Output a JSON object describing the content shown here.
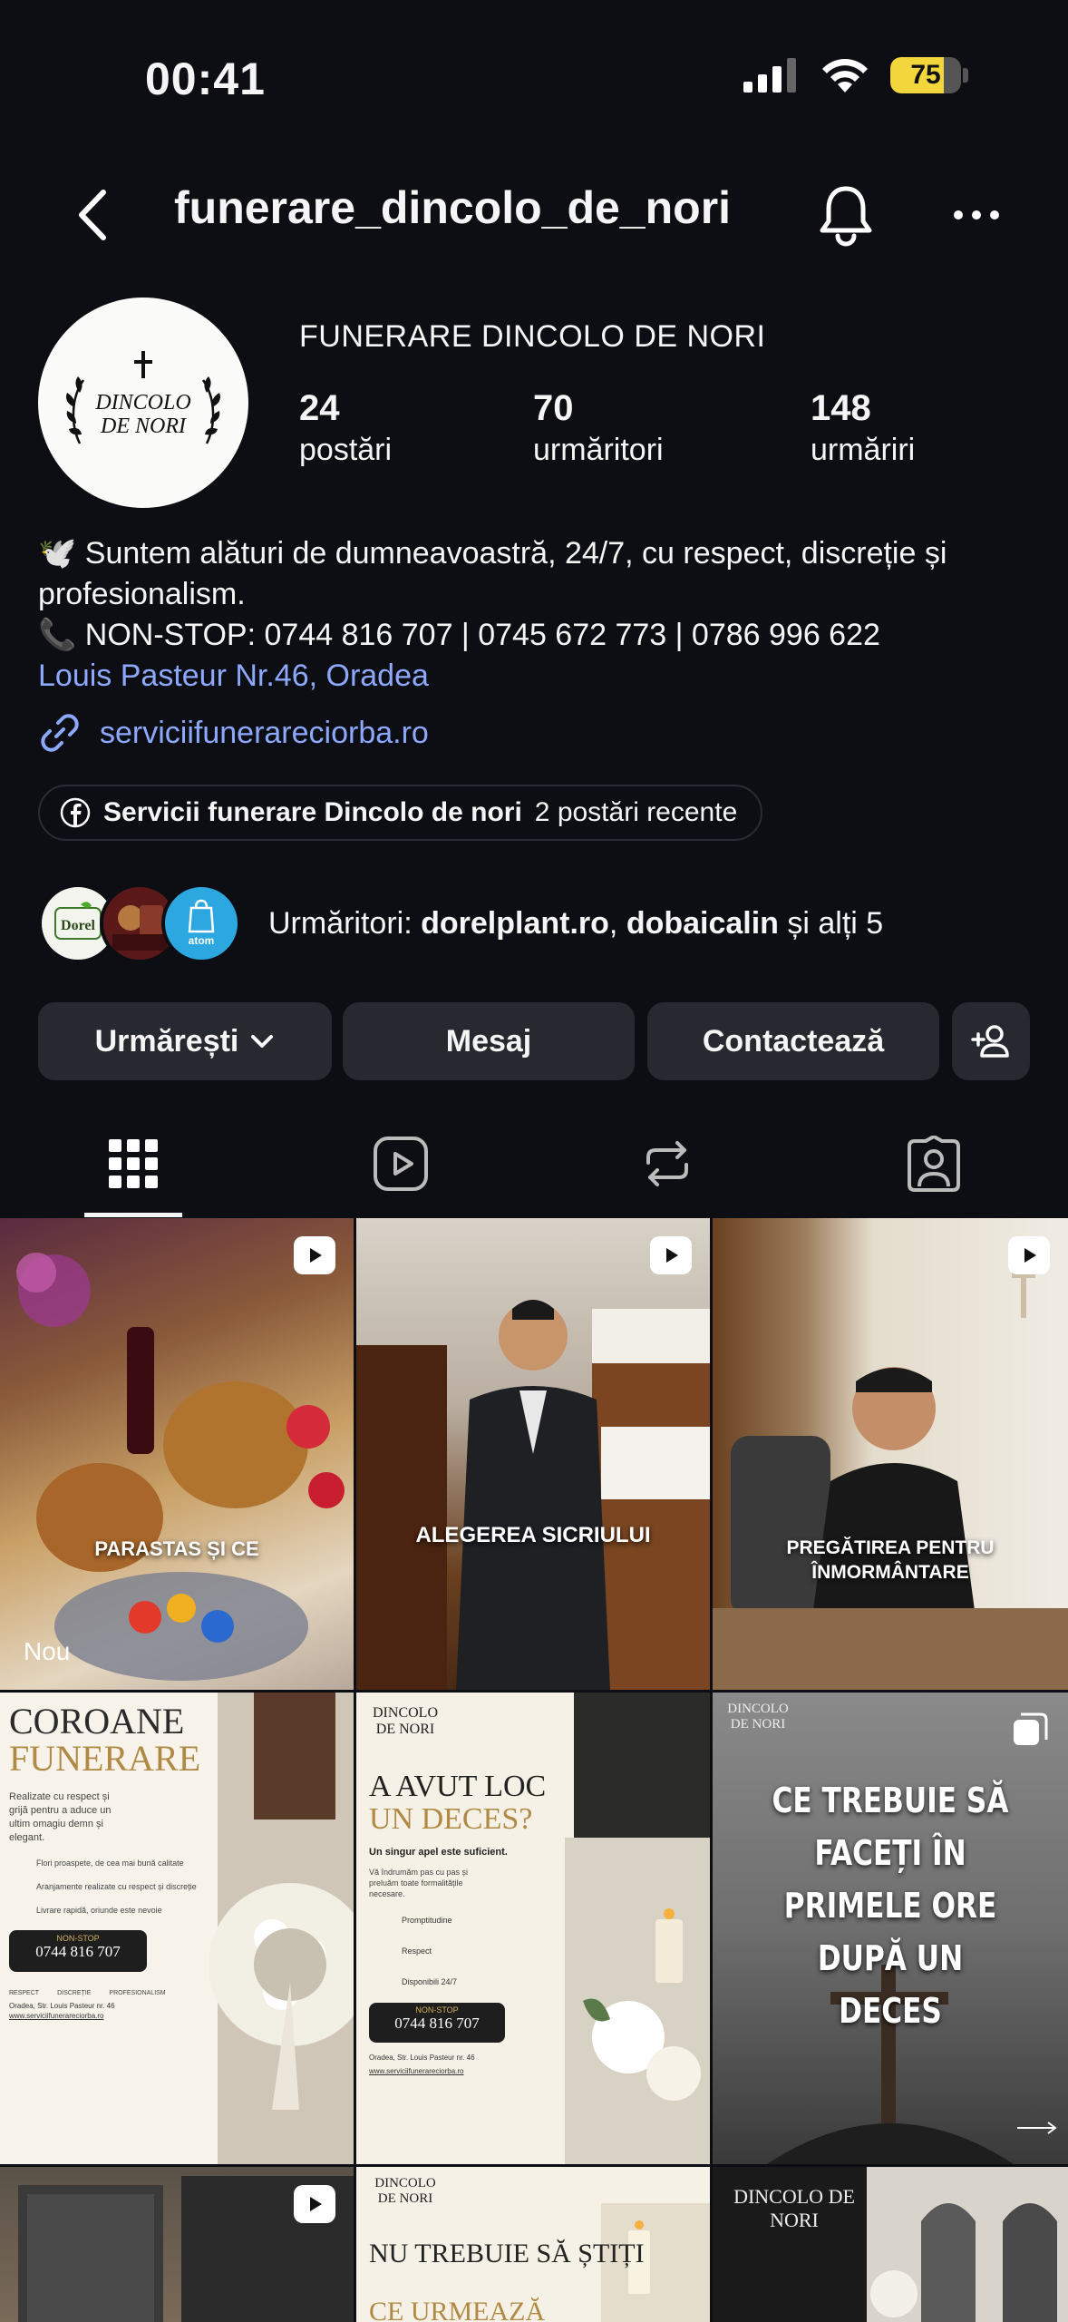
{
  "status_bar": {
    "time": "00:41",
    "battery": "75",
    "battery_level": 0.75
  },
  "header": {
    "username": "funerare_dincolo_de_nori"
  },
  "profile": {
    "display_name": "FUNERARE DINCOLO DE NORI",
    "avatar_logo": "DINCOLO DE NORI",
    "stats": [
      {
        "value": "24",
        "label": "postări"
      },
      {
        "value": "70",
        "label": "urmăritori"
      },
      {
        "value": "148",
        "label": "urmăriri"
      }
    ],
    "bio": {
      "line1": "🕊️ Suntem alături de dumneavoastră, 24/7, cu respect, discreție și profesionalism.",
      "line2": "📞 NON-STOP: 0744 816 707 | 0745 672 773 | 0786 996 622",
      "address": "Louis Pasteur Nr.46, Oradea"
    },
    "website": "serviciifunerareciorba.ro",
    "facebook": {
      "name": "Servicii funerare Dincolo de nori",
      "recent": "2 postări recente"
    },
    "followers_preview": {
      "prefix": "Urmăritori: ",
      "names": "dorelplant.ro",
      "sep": ", ",
      "names2": "dobaicalin",
      "suffix": " și alți 5"
    }
  },
  "buttons": {
    "follow": "Urmărești",
    "message": "Mesaj",
    "contact": "Contactează"
  },
  "grid": {
    "post1": {
      "caption": "PARASTAS ȘI CE",
      "badge": "Nou"
    },
    "post2": {
      "caption": "ALEGEREA SICRIULUI"
    },
    "post3": {
      "caption": "PREGĂTIREA PENTRU ÎNMORMÂNTARE"
    },
    "post4": {
      "title1": "COROANE",
      "title2": "FUNERARE",
      "intro": "Realizate cu respect și grijă pentru a aduce un ultim omagiu demn și elegant.",
      "items": [
        "Flori proaspete, de cea mai bună calitate",
        "Aranjamente realizate cu respect și discreție",
        "Livrare rapidă, oriunde este nevoie"
      ],
      "nonstop": "NON-STOP",
      "phone": "0744 816 707",
      "badges": [
        "RESPECT",
        "DISCREȚIE",
        "PROFESIONALISM"
      ],
      "address": "Oradea, Str. Louis Pasteur nr. 46",
      "site": "www.serviciifunerareciorba.ro"
    },
    "post5": {
      "logo": "DINCOLO DE NORI",
      "title1": "A AVUT LOC",
      "title2": "UN DECES?",
      "subtitle": "Un singur apel este suficient.",
      "body": "Vă îndrumăm pas cu pas și preluăm toate formalitățile necesare.",
      "items": [
        "Promptitudine",
        "Respect",
        "Disponibili 24/7"
      ],
      "nonstop": "NON-STOP",
      "phone": "0744 816 707",
      "address": "Oradea, Str. Louis Pasteur nr. 46",
      "site": "www.serviciifunerareciorba.ro"
    },
    "post6": {
      "logo": "DINCOLO DE NORI",
      "text": "CE TREBUIE SĂ FACEȚI ÎN PRIMELE ORE DUPĂ UN DECES"
    },
    "post8": {
      "logo": "DINCOLO DE NORI",
      "title": "NU TREBUIE SĂ ȘTIȚI",
      "title2": "CE URMEAZĂ"
    },
    "post9": {
      "logo": "DINCOLO DE NORI"
    }
  }
}
